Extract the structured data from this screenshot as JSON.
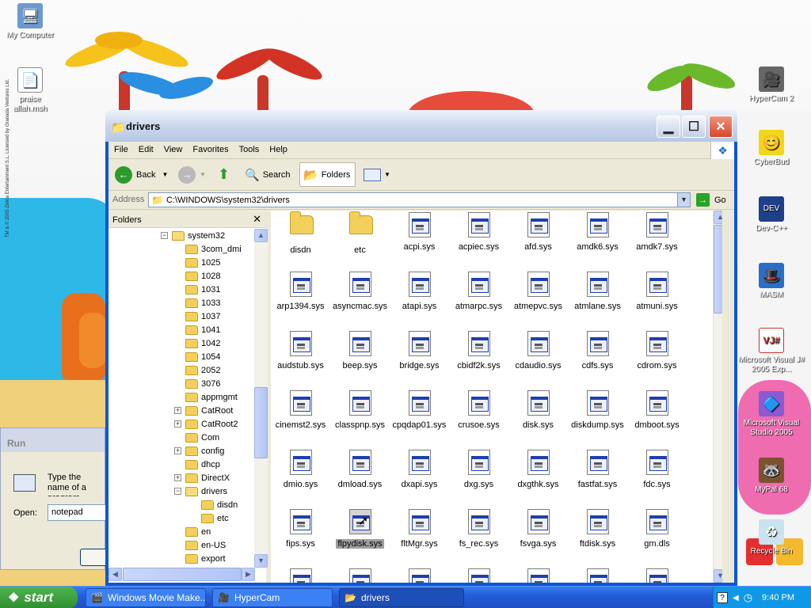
{
  "desktop": {
    "left_icons": [
      {
        "label": "My Computer",
        "icon": "computer-icon",
        "glyph": "🖥"
      },
      {
        "label": "praise\nallah.msh",
        "icon": "shortcut-file-icon",
        "glyph": "📄"
      }
    ],
    "right_icons": [
      {
        "label": "HyperCam 2",
        "icon": "hypercam-icon",
        "glyph": "🎥"
      },
      {
        "label": "CyberBud",
        "icon": "cyberbud-icon",
        "glyph": "😊"
      },
      {
        "label": "Dev-C++",
        "icon": "devcpp-icon",
        "glyph": "💻"
      },
      {
        "label": "MASM",
        "icon": "masm-icon",
        "glyph": "🎩"
      },
      {
        "label": "Microsoft Visual J# 2005 Exp...",
        "icon": "visual-j-icon",
        "glyph": "☕"
      },
      {
        "label": "Microsoft Visual Studio 2005",
        "icon": "visual-studio-icon",
        "glyph": "🔷"
      },
      {
        "label": "MyPal 68",
        "icon": "mypal-icon",
        "glyph": "🦝"
      },
      {
        "label": "Recycle Bin",
        "icon": "recycle-bin-icon",
        "glyph": "♻"
      }
    ],
    "copyright_vertical": "TM & © 2005 Zinkia Entertainment S.L. Licensed by Granada Ventures Ltd."
  },
  "explorer": {
    "title": "drivers",
    "menu": [
      "File",
      "Edit",
      "View",
      "Favorites",
      "Tools",
      "Help"
    ],
    "toolbar": {
      "back": "Back",
      "search": "Search",
      "folders": "Folders"
    },
    "address": {
      "label": "Address",
      "value": "C:\\WINDOWS\\system32\\drivers",
      "go": "Go"
    },
    "folders_pane": {
      "title": "Folders",
      "tree": [
        {
          "label": "system32",
          "expander": "−",
          "open": true
        },
        {
          "label": "3com_dmi",
          "expander": ""
        },
        {
          "label": "1025",
          "expander": ""
        },
        {
          "label": "1028",
          "expander": ""
        },
        {
          "label": "1031",
          "expander": ""
        },
        {
          "label": "1033",
          "expander": ""
        },
        {
          "label": "1037",
          "expander": ""
        },
        {
          "label": "1041",
          "expander": ""
        },
        {
          "label": "1042",
          "expander": ""
        },
        {
          "label": "1054",
          "expander": ""
        },
        {
          "label": "2052",
          "expander": ""
        },
        {
          "label": "3076",
          "expander": ""
        },
        {
          "label": "appmgmt",
          "expander": ""
        },
        {
          "label": "CatRoot",
          "expander": "+"
        },
        {
          "label": "CatRoot2",
          "expander": "+"
        },
        {
          "label": "Com",
          "expander": ""
        },
        {
          "label": "config",
          "expander": "+"
        },
        {
          "label": "dhcp",
          "expander": ""
        },
        {
          "label": "DirectX",
          "expander": "+"
        },
        {
          "label": "drivers",
          "expander": "−",
          "open": true
        },
        {
          "label": "disdn",
          "expander": "",
          "child": true
        },
        {
          "label": "etc",
          "expander": "",
          "child": true
        },
        {
          "label": "en",
          "expander": ""
        },
        {
          "label": "en-US",
          "expander": ""
        },
        {
          "label": "export",
          "expander": ""
        }
      ]
    },
    "files": [
      {
        "name": "disdn",
        "kind": "folder"
      },
      {
        "name": "etc",
        "kind": "folder"
      },
      {
        "name": "acpi.sys",
        "kind": "sys"
      },
      {
        "name": "acpiec.sys",
        "kind": "sys"
      },
      {
        "name": "afd.sys",
        "kind": "sys"
      },
      {
        "name": "amdk6.sys",
        "kind": "sys"
      },
      {
        "name": "amdk7.sys",
        "kind": "sys"
      },
      {
        "name": "arp1394.sys",
        "kind": "sys"
      },
      {
        "name": "asyncmac.sys",
        "kind": "sys"
      },
      {
        "name": "atapi.sys",
        "kind": "sys"
      },
      {
        "name": "atmarpc.sys",
        "kind": "sys"
      },
      {
        "name": "atmepvc.sys",
        "kind": "sys"
      },
      {
        "name": "atmlane.sys",
        "kind": "sys"
      },
      {
        "name": "atmuni.sys",
        "kind": "sys"
      },
      {
        "name": "audstub.sys",
        "kind": "sys"
      },
      {
        "name": "beep.sys",
        "kind": "sys"
      },
      {
        "name": "bridge.sys",
        "kind": "sys"
      },
      {
        "name": "cbidf2k.sys",
        "kind": "sys"
      },
      {
        "name": "cdaudio.sys",
        "kind": "sys"
      },
      {
        "name": "cdfs.sys",
        "kind": "sys"
      },
      {
        "name": "cdrom.sys",
        "kind": "sys"
      },
      {
        "name": "cinemst2.sys",
        "kind": "sys"
      },
      {
        "name": "classpnp.sys",
        "kind": "sys"
      },
      {
        "name": "cpqdap01.sys",
        "kind": "sys"
      },
      {
        "name": "crusoe.sys",
        "kind": "sys"
      },
      {
        "name": "disk.sys",
        "kind": "sys"
      },
      {
        "name": "diskdump.sys",
        "kind": "sys"
      },
      {
        "name": "dmboot.sys",
        "kind": "sys"
      },
      {
        "name": "dmio.sys",
        "kind": "sys"
      },
      {
        "name": "dmload.sys",
        "kind": "sys"
      },
      {
        "name": "dxapi.sys",
        "kind": "sys"
      },
      {
        "name": "dxg.sys",
        "kind": "sys"
      },
      {
        "name": "dxgthk.sys",
        "kind": "sys"
      },
      {
        "name": "fastfat.sys",
        "kind": "sys"
      },
      {
        "name": "fdc.sys",
        "kind": "sys"
      },
      {
        "name": "fips.sys",
        "kind": "sys"
      },
      {
        "name": "flpydisk.sys",
        "kind": "sys",
        "selected": true
      },
      {
        "name": "fltMgr.sys",
        "kind": "sys"
      },
      {
        "name": "fs_rec.sys",
        "kind": "sys"
      },
      {
        "name": "fsvga.sys",
        "kind": "sys"
      },
      {
        "name": "ftdisk.sys",
        "kind": "sys"
      },
      {
        "name": "gm.dls",
        "kind": "sys"
      },
      {
        "name": "",
        "kind": "sys"
      },
      {
        "name": "",
        "kind": "sys"
      },
      {
        "name": "",
        "kind": "sys"
      },
      {
        "name": "",
        "kind": "sys"
      },
      {
        "name": "",
        "kind": "sys"
      },
      {
        "name": "",
        "kind": "sys"
      },
      {
        "name": "",
        "kind": "sys"
      }
    ]
  },
  "run_dialog": {
    "title": "Run",
    "text": "Type the name of a program, folder, document, or Internet resource",
    "open_label": "Open:",
    "open_value": "notepad"
  },
  "taskbar": {
    "start": "start",
    "tasks": [
      {
        "label": "Windows Movie Make...",
        "icon": "movie-maker-icon"
      },
      {
        "label": "HyperCam",
        "icon": "hypercam-task-icon"
      },
      {
        "label": "drivers",
        "icon": "folder-task-icon",
        "active": true
      }
    ],
    "clock": "9:40 PM"
  }
}
